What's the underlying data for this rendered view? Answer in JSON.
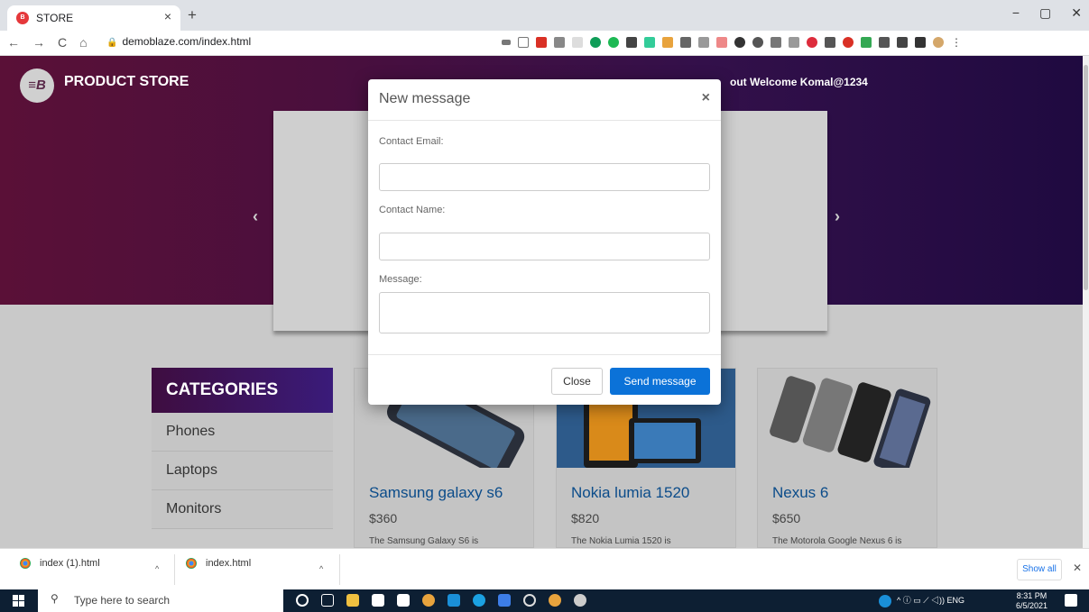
{
  "browser": {
    "tab_title": "STORE",
    "tab_close": "×",
    "new_tab": "+",
    "url": "demoblaze.com/index.html",
    "window_controls": [
      "−",
      "▢",
      "✕"
    ],
    "nav_icons": [
      "back-icon",
      "forward-icon",
      "reload-icon",
      "home-icon"
    ]
  },
  "site": {
    "brand": "PRODUCT STORE",
    "logo_text": "≡B",
    "nav_partial": "out   Welcome Komal@1234",
    "carousel_prev": "‹",
    "carousel_next": "›"
  },
  "categories": {
    "title": "CATEGORIES",
    "items": [
      "Phones",
      "Laptops",
      "Monitors"
    ]
  },
  "products": [
    {
      "name": "Samsung galaxy s6",
      "price": "$360",
      "desc": "The Samsung Galaxy S6 is"
    },
    {
      "name": "Nokia lumia 1520",
      "price": "$820",
      "desc": "The Nokia Lumia 1520 is"
    },
    {
      "name": "Nexus 6",
      "price": "$650",
      "desc": "The Motorola Google Nexus 6 is"
    }
  ],
  "modal": {
    "title": "New message",
    "close_x": "×",
    "email_label": "Contact Email:",
    "name_label": "Contact Name:",
    "message_label": "Message:",
    "close_button": "Close",
    "send_button": "Send message"
  },
  "downloads": {
    "items": [
      "index (1).html",
      "index.html"
    ],
    "caret": "^",
    "show_all": "Show all",
    "close": "✕"
  },
  "taskbar": {
    "search_placeholder": "Type here to search",
    "tray_text": "^  ⓘ ▭ ⟋ ◁)) ENG",
    "time": "8:31 PM",
    "date": "6/5/2021"
  },
  "colors": {
    "send_button": "#0b72d8",
    "product_link": "#0b4c8a",
    "hero_start": "#5a1037",
    "hero_end": "#1f0a40"
  }
}
